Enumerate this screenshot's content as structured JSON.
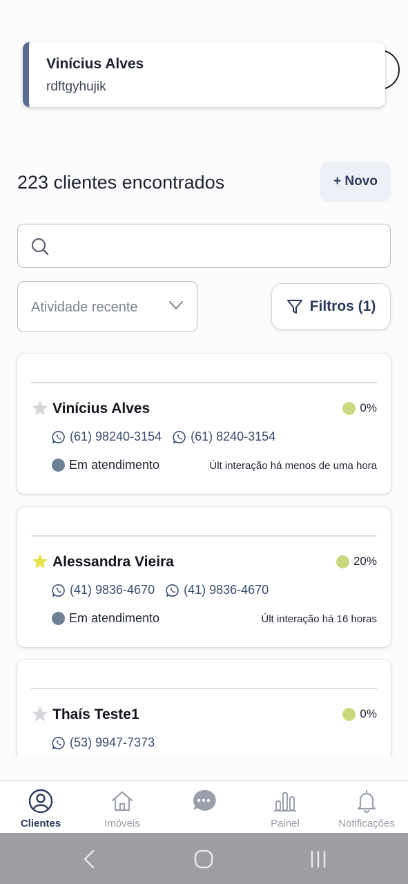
{
  "toast": {
    "title": "Vinícius Alves",
    "message": "rdftgyhujik"
  },
  "header": {
    "count_text": "223 clientes encontrados",
    "new_button_label": "+ Novo"
  },
  "search": {
    "value": "",
    "placeholder": ""
  },
  "sort": {
    "selected": "Atividade recente"
  },
  "filters": {
    "label": "Filtros (1)"
  },
  "clients": [
    {
      "name": "Vinícius Alves",
      "starred": false,
      "score": "0%",
      "phones": [
        "(61) 98240-3154",
        "(61) 8240-3154"
      ],
      "status": "Em atendimento",
      "last_interaction": "Últ interação há menos de uma hora"
    },
    {
      "name": "Alessandra Vieira",
      "starred": true,
      "score": "20%",
      "phones": [
        "(41) 9836-4670",
        "(41) 9836-4670"
      ],
      "status": "Em atendimento",
      "last_interaction": "Últ interação há 16 horas"
    },
    {
      "name": "Thaís Teste1",
      "starred": false,
      "score": "0%",
      "phones": [
        "(53) 9947-7373"
      ]
    }
  ],
  "bottom_nav": {
    "items": [
      {
        "label": "Clientes",
        "icon": "user-circle-icon",
        "active": true
      },
      {
        "label": "Imóveis",
        "icon": "home-icon",
        "active": false
      },
      {
        "label": "",
        "icon": "chat-icon",
        "active": false
      },
      {
        "label": "Painel",
        "icon": "bar-chart-icon",
        "active": false
      },
      {
        "label": "Notificações",
        "icon": "bell-icon",
        "active": false
      }
    ]
  },
  "colors": {
    "accent": "#2c3a5b",
    "toast_bar": "#5a6b8e",
    "score_dot": "#cbd97e",
    "status_dot": "#6e7f96",
    "star_active": "#e8e14a",
    "star_inactive": "#d3d5da"
  }
}
